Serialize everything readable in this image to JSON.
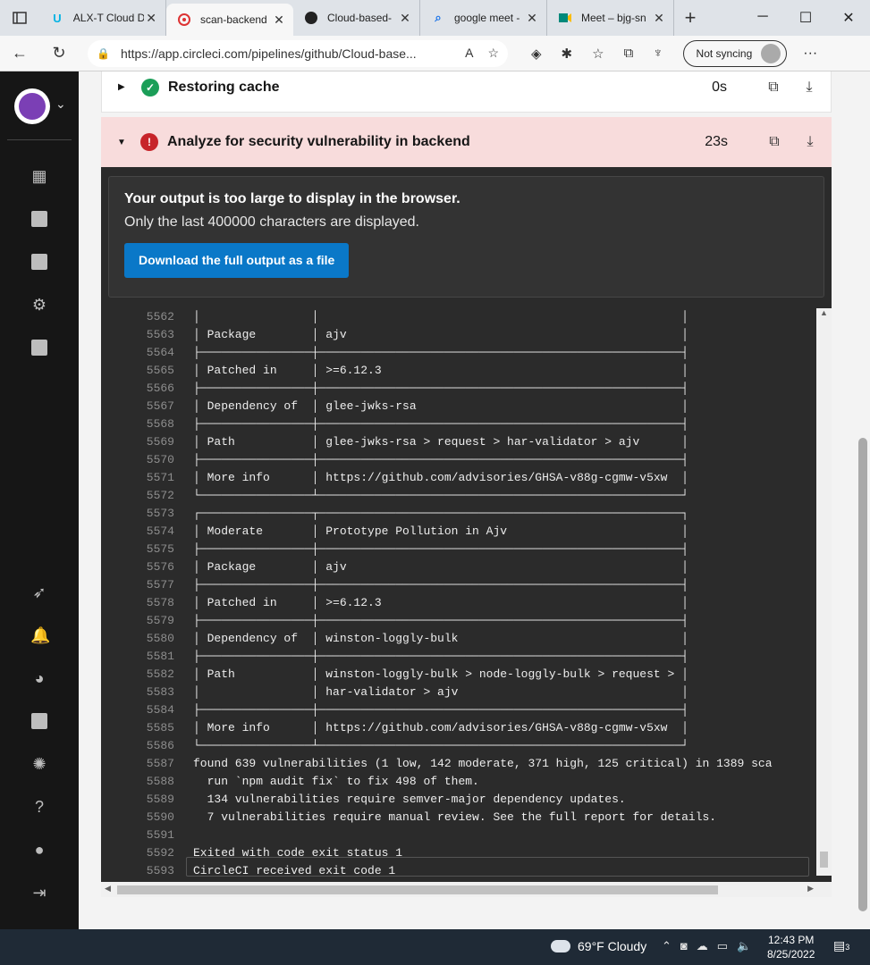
{
  "browser": {
    "tabs": [
      {
        "title": "ALX-T Cloud D",
        "icon": "udacity-icon",
        "active": false
      },
      {
        "title": "scan-backend",
        "icon": "circleci-icon",
        "active": true
      },
      {
        "title": "Cloud-based-",
        "icon": "github-icon",
        "active": false
      },
      {
        "title": "google meet -",
        "icon": "search-icon",
        "active": false
      },
      {
        "title": "Meet – bjg-sn",
        "icon": "meet-icon",
        "active": false
      }
    ],
    "url": "https://app.circleci.com/pipelines/github/Cloud-base...",
    "sync_label": "Not syncing"
  },
  "steps": [
    {
      "name": "Restoring cache",
      "duration": "0s",
      "status": "success"
    },
    {
      "name": "Analyze for security vulnerability in backend",
      "duration": "23s",
      "status": "failed"
    }
  ],
  "notice": {
    "title": "Your output is too large to display in the browser.",
    "subtitle": "Only the last 400000 characters are displayed.",
    "button": "Download the full output as a file"
  },
  "log_lines": [
    {
      "n": "5562",
      "t": "│                │                                                    │"
    },
    {
      "n": "5563",
      "t": "│ Package        │ ajv                                                │"
    },
    {
      "n": "5564",
      "t": "├────────────────┼────────────────────────────────────────────────────┤"
    },
    {
      "n": "5565",
      "t": "│ Patched in     │ >=6.12.3                                           │"
    },
    {
      "n": "5566",
      "t": "├────────────────┼────────────────────────────────────────────────────┤"
    },
    {
      "n": "5567",
      "t": "│ Dependency of  │ glee-jwks-rsa                                      │"
    },
    {
      "n": "5568",
      "t": "├────────────────┼────────────────────────────────────────────────────┤"
    },
    {
      "n": "5569",
      "t": "│ Path           │ glee-jwks-rsa > request > har-validator > ajv      │"
    },
    {
      "n": "5570",
      "t": "├────────────────┼────────────────────────────────────────────────────┤"
    },
    {
      "n": "5571",
      "t": "│ More info      │ https://github.com/advisories/GHSA-v88g-cgmw-v5xw  │"
    },
    {
      "n": "5572",
      "t": "└────────────────┴────────────────────────────────────────────────────┘"
    },
    {
      "n": "5573",
      "t": "┌────────────────┬────────────────────────────────────────────────────┐"
    },
    {
      "n": "5574",
      "t": "│ Moderate       │ Prototype Pollution in Ajv                         │"
    },
    {
      "n": "5575",
      "t": "├────────────────┼────────────────────────────────────────────────────┤"
    },
    {
      "n": "5576",
      "t": "│ Package        │ ajv                                                │"
    },
    {
      "n": "5577",
      "t": "├────────────────┼────────────────────────────────────────────────────┤"
    },
    {
      "n": "5578",
      "t": "│ Patched in     │ >=6.12.3                                           │"
    },
    {
      "n": "5579",
      "t": "├────────────────┼────────────────────────────────────────────────────┤"
    },
    {
      "n": "5580",
      "t": "│ Dependency of  │ winston-loggly-bulk                                │"
    },
    {
      "n": "5581",
      "t": "├────────────────┼────────────────────────────────────────────────────┤"
    },
    {
      "n": "5582",
      "t": "│ Path           │ winston-loggly-bulk > node-loggly-bulk > request > │"
    },
    {
      "n": "5583",
      "t": "│                │ har-validator > ajv                                │"
    },
    {
      "n": "5584",
      "t": "├────────────────┼────────────────────────────────────────────────────┤"
    },
    {
      "n": "5585",
      "t": "│ More info      │ https://github.com/advisories/GHSA-v88g-cgmw-v5xw  │"
    },
    {
      "n": "5586",
      "t": "└────────────────┴────────────────────────────────────────────────────┘"
    },
    {
      "n": "5587",
      "t": "found 639 vulnerabilities (1 low, 142 moderate, 371 high, 125 critical) in 1389 sca"
    },
    {
      "n": "5588",
      "t": "  run `npm audit fix` to fix 498 of them."
    },
    {
      "n": "5589",
      "t": "  134 vulnerabilities require semver-major dependency updates."
    },
    {
      "n": "5590",
      "t": "  7 vulnerabilities require manual review. See the full report for details."
    },
    {
      "n": "5591",
      "t": ""
    },
    {
      "n": "5592",
      "t": "Exited with code exit status 1"
    },
    {
      "n": "5593",
      "t": "CircleCI received exit code 1"
    }
  ],
  "taskbar": {
    "weather": "69°F  Cloudy",
    "time": "12:43 PM",
    "date": "8/25/2022",
    "notifications": "3"
  }
}
